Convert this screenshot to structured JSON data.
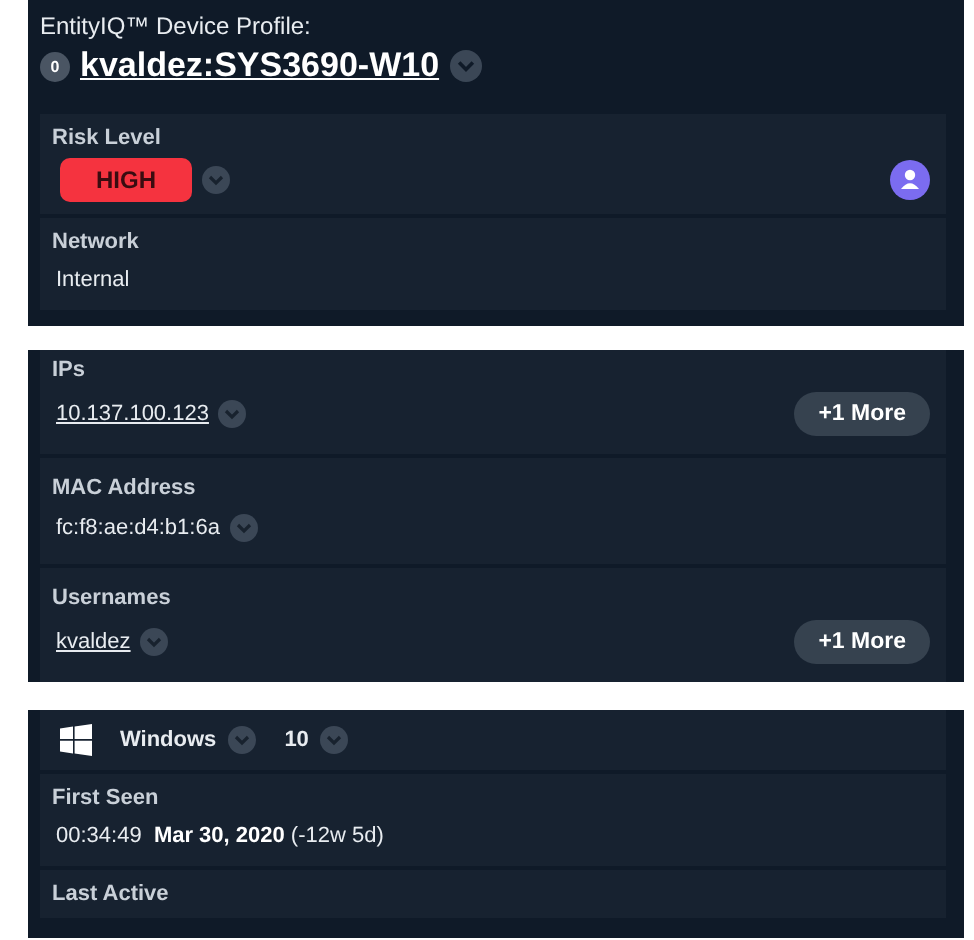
{
  "header": {
    "title": "EntityIQ™ Device Profile:",
    "badge": "0",
    "device_name": "kvaldez:SYS3690-W10"
  },
  "slices": [
    {
      "cards": [
        {
          "kind": "risk",
          "label": "Risk Level",
          "value": "HIGH",
          "color": "#f5333f"
        },
        {
          "kind": "text",
          "label": "Network",
          "value": "Internal"
        }
      ]
    },
    {
      "cards": [
        {
          "kind": "link",
          "label": "IPs",
          "value": "10.137.100.123",
          "more": "+1 More"
        },
        {
          "kind": "text",
          "label": "MAC Address",
          "value": "fc:f8:ae:d4:b1:6a",
          "chevron": true
        },
        {
          "kind": "link",
          "label": "Usernames",
          "value": "kvaldez",
          "more": "+1 More"
        }
      ]
    },
    {
      "cards": [
        {
          "kind": "os",
          "name": "Windows",
          "version": "10"
        },
        {
          "kind": "date",
          "label": "First Seen",
          "time": "00:34:49",
          "date": "Mar 30, 2020",
          "ago": "(-12w 5d)"
        },
        {
          "kind": "text",
          "label": "Last Active"
        }
      ]
    }
  ]
}
